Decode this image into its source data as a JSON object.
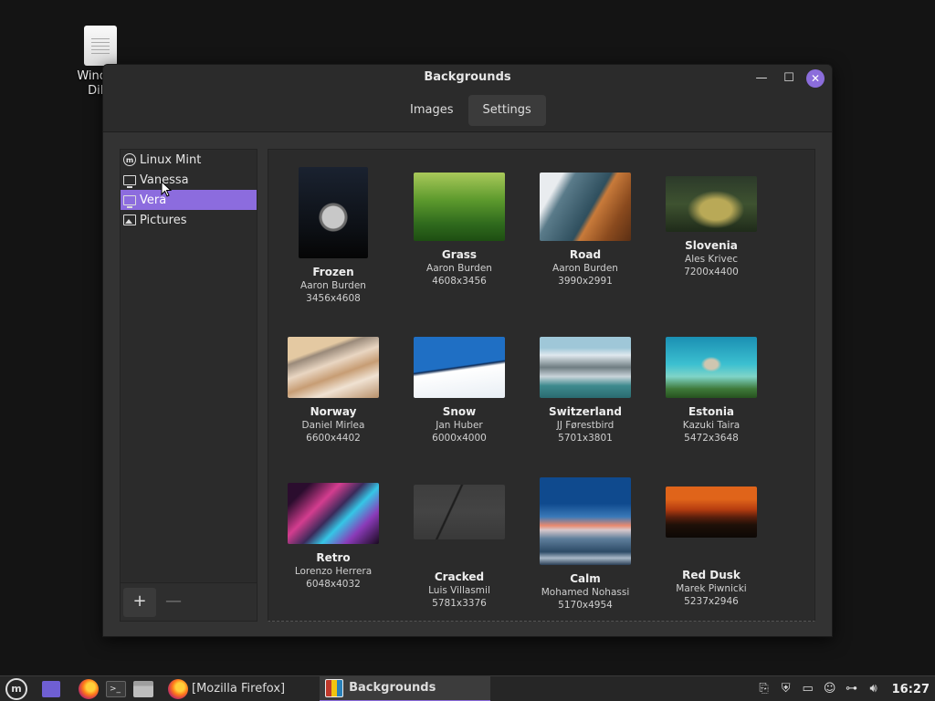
{
  "desktop": {
    "icon_label_line1": "Window",
    "icon_label_line2": "DiLs"
  },
  "window": {
    "title": "Backgrounds",
    "minimize_glyph": "—",
    "maximize_glyph": "☐",
    "close_glyph": "✕",
    "tabs": [
      {
        "label": "Images",
        "active": false
      },
      {
        "label": "Settings",
        "active": true
      }
    ]
  },
  "sidebar": {
    "items": [
      {
        "label": "Linux Mint",
        "icon": "mint-icon",
        "active": false
      },
      {
        "label": "Vanessa",
        "icon": "monitor-icon",
        "active": false
      },
      {
        "label": "Vera",
        "icon": "monitor-icon",
        "active": true
      },
      {
        "label": "Pictures",
        "icon": "picture-icon",
        "active": false
      }
    ],
    "add_label": "+",
    "remove_label": "—"
  },
  "backgrounds": [
    {
      "name": "Frozen",
      "author": "Aaron Burden",
      "size": "3456x4608"
    },
    {
      "name": "Grass",
      "author": "Aaron Burden",
      "size": "4608x3456"
    },
    {
      "name": "Road",
      "author": "Aaron Burden",
      "size": "3990x2991"
    },
    {
      "name": "Slovenia",
      "author": "Ales Krivec",
      "size": "7200x4400"
    },
    {
      "name": "Norway",
      "author": "Daniel Mirlea",
      "size": "6600x4402"
    },
    {
      "name": "Snow",
      "author": "Jan Huber",
      "size": "6000x4000"
    },
    {
      "name": "Switzerland",
      "author": "JJ Førestbird",
      "size": "5701x3801"
    },
    {
      "name": "Estonia",
      "author": "Kazuki Taira",
      "size": "5472x3648"
    },
    {
      "name": "Retro",
      "author": "Lorenzo Herrera",
      "size": "6048x4032"
    },
    {
      "name": "Cracked",
      "author": "Luis Villasmil",
      "size": "5781x3376"
    },
    {
      "name": "Calm",
      "author": "Mohamed Nohassi",
      "size": "5170x4954"
    },
    {
      "name": "Red Dusk",
      "author": "Marek Piwnicki",
      "size": "5237x2946"
    }
  ],
  "taskbar": {
    "firefox_label": "[Mozilla Firefox]",
    "backgrounds_label": "Backgrounds",
    "clock": "16:27"
  },
  "colors": {
    "accent": "#8c6cde",
    "close_button": "#8b6ddb"
  }
}
